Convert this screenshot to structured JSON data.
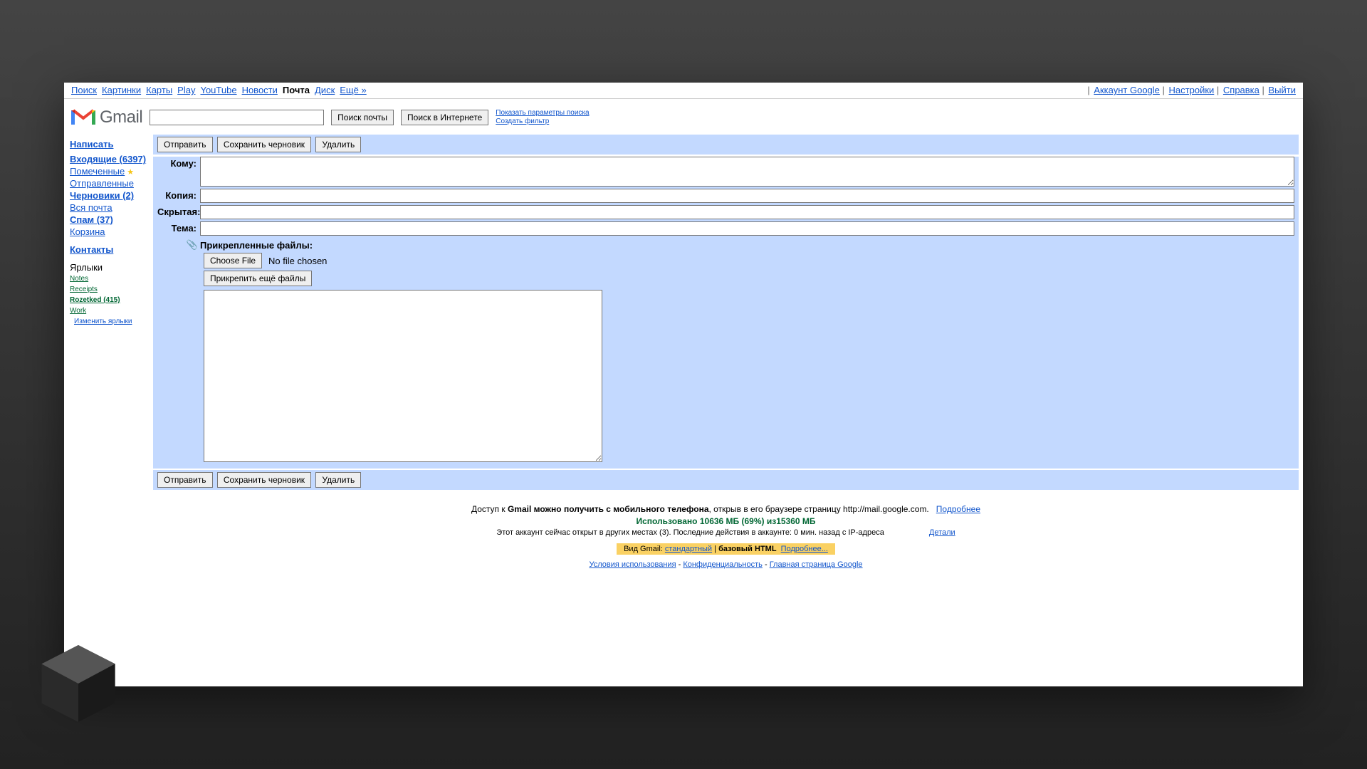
{
  "topnav": {
    "left": [
      "Поиск",
      "Картинки",
      "Карты",
      "Play",
      "YouTube",
      "Новости",
      "Почта",
      "Диск",
      "Ещё »"
    ],
    "current_index": 6,
    "right": [
      "Аккаунт Google",
      "Настройки",
      "Справка",
      "Выйти"
    ]
  },
  "brand": "Gmail",
  "search": {
    "btn_mail": "Поиск почты",
    "btn_web": "Поиск в Интернете",
    "link_params": "Показать параметры поиска",
    "link_filter": "Создать фильтр"
  },
  "sidebar": {
    "compose": "Написать",
    "folders": [
      {
        "label": "Входящие (6397)",
        "bold": true
      },
      {
        "label": "Помеченные",
        "star": true
      },
      {
        "label": "Отправленные"
      },
      {
        "label": "Черновики (2)",
        "bold": true
      },
      {
        "label": "Вся почта"
      },
      {
        "label": "Спам (37)",
        "bold": true
      },
      {
        "label": "Корзина"
      }
    ],
    "contacts": "Контакты",
    "labels_title": "Ярлыки",
    "labels": [
      "Notes",
      "Receipts",
      "Rozetked (415)",
      "Work"
    ],
    "labels_bold_idx": 2,
    "edit_labels": "Изменить ярлыки"
  },
  "toolbar": {
    "send": "Отправить",
    "save_draft": "Сохранить черновик",
    "delete": "Удалить"
  },
  "compose": {
    "to_label": "Кому:",
    "cc_label": "Копия:",
    "bcc_label": "Скрытая:",
    "subject_label": "Тема:",
    "attach_title": "Прикрепленные файлы:",
    "choose_file": "Choose File",
    "no_file": "No file chosen",
    "more_files": "Прикрепить ещё файлы"
  },
  "footer": {
    "mobile_prefix": "Доступ к ",
    "mobile_bold": "Gmail можно получить с мобильного телефона",
    "mobile_suffix": ", открыв в его браузере страницу http://mail.google.com.",
    "more": "Подробнее",
    "storage": "Использовано 10636 МБ (69%) из15360 МБ",
    "sessions": "Этот аккаунт сейчас открыт в других местах (3).   Последние действия в аккаунте: 0 мин. назад с IP-адреса",
    "details": "Детали",
    "view_prefix": "Вид Gmail: ",
    "view_standard": "стандартный",
    "view_sep": " | ",
    "view_basic": "базовый HTML",
    "view_more": "Подробнее...",
    "terms": "Условия использования",
    "privacy": "Конфиденциальность",
    "home": "Главная страница Google"
  }
}
